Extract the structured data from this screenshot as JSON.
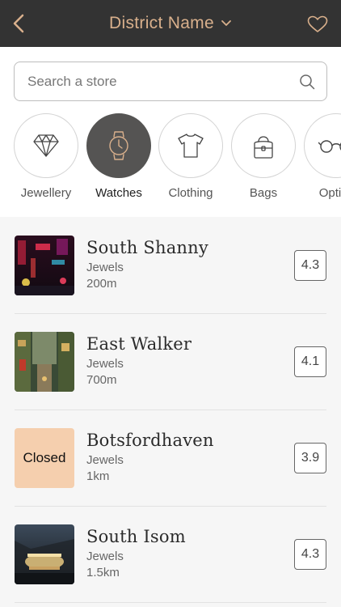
{
  "header": {
    "title": "District Name",
    "colors": {
      "background": "#333333",
      "accent": "#d9b08c"
    },
    "icons": {
      "back": "chevron-left-icon",
      "title_dropdown": "chevron-down-icon",
      "favorite": "heart-icon"
    }
  },
  "search": {
    "placeholder": "Search a store",
    "value": "",
    "icon": "search-icon"
  },
  "categories": [
    {
      "label": "Jewellery",
      "icon": "diamond-icon",
      "active": false
    },
    {
      "label": "Watches",
      "icon": "watch-icon",
      "active": true
    },
    {
      "label": "Clothing",
      "icon": "shirt-icon",
      "active": false
    },
    {
      "label": "Bags",
      "icon": "bag-icon",
      "active": false
    },
    {
      "label": "Optics",
      "icon": "glasses-icon",
      "active": false
    }
  ],
  "stores": [
    {
      "name": "South Shanny",
      "category": "Jewels",
      "distance": "200m",
      "rating": "4.3",
      "status": "open",
      "thumb": "neon-street-night"
    },
    {
      "name": "East Walker",
      "category": "Jewels",
      "distance": "700m",
      "rating": "4.1",
      "status": "open",
      "thumb": "alley-street"
    },
    {
      "name": "Botsfordhaven",
      "category": "Jewels",
      "distance": "1km",
      "rating": "3.9",
      "status": "closed",
      "status_label": "Closed",
      "thumb": "closed-overlay"
    },
    {
      "name": "South Isom",
      "category": "Jewels",
      "distance": "1.5km",
      "rating": "4.3",
      "status": "open",
      "thumb": "carousel-night"
    }
  ]
}
